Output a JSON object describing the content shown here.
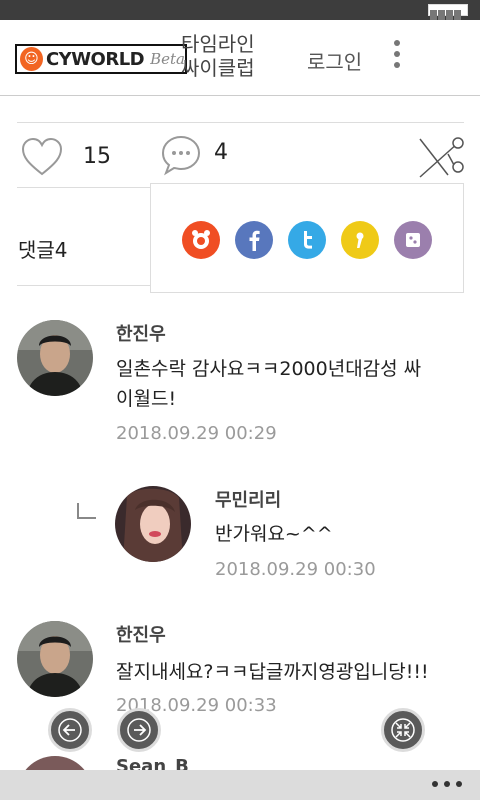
{
  "header": {
    "logo_text": "CYWORLD",
    "logo_beta": "Beta",
    "cycle_line1": "타임라인",
    "cycle_line2": "싸이클럽",
    "login": "로그인"
  },
  "stats": {
    "likes": "15",
    "comments": "4"
  },
  "comments_header": "댓글4",
  "comments": [
    {
      "name": "한진우",
      "text_line1": "일촌수락 감사요ㅋㅋ2000년대감성 싸",
      "text_line2": "이월드!",
      "time": "2018.09.29 00:29"
    },
    {
      "name": "무민리리",
      "text": "반가워요~^^",
      "time": "2018.09.29 00:30"
    },
    {
      "name": "한진우",
      "text": "잘지내세요?ㅋㅋ답글까지영광입니당!!!",
      "time": "2018.09.29 00:33"
    },
    {
      "name": "Sean_B"
    }
  ],
  "share_targets": [
    "cyworld-icon",
    "facebook-icon",
    "twitter-icon",
    "kakaostory-icon",
    "band-icon"
  ],
  "colors": {
    "cyworld": "#f04e23",
    "facebook": "#5877bd",
    "twitter": "#35a9e6",
    "kakao": "#efca17",
    "band": "#9b7fad"
  }
}
